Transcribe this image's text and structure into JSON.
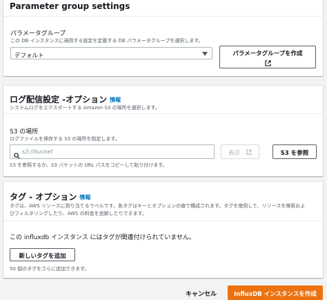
{
  "parameter_group": {
    "title": "Parameter group settings",
    "label": "パラメータグループ",
    "description": "この DB インスタンスに適用する設定を定義する DB パラメータグループを選択します。",
    "selected": "デフォルト",
    "create_button": "パラメータグループを作成"
  },
  "log_delivery": {
    "title": "ログ配信設定 -オプション",
    "info": "情報",
    "description": "システムログをエクスポートする Amazon S3 の場所を選択します。",
    "s3_label": "S3 の場所",
    "s3_description": "ログファイルを保存する S3 の場所を指定します。",
    "s3_placeholder": "s3://bucket",
    "view_button": "表示",
    "browse_button": "S3 を参照",
    "s3_hint": "S3 を参照するか、S3 バケットの URL パスをコピーして貼り付けます。"
  },
  "tags": {
    "title": "タグ - オプション",
    "info": "情報",
    "description_line1": "タグは、AWS リソースに割り当てるラベルです。各タグはキーとオプションの値で構成されます。タグを使用して、リソースを検索およ",
    "description_line2": "びフィルタリングしたり、AWS の料金を追跡したりできます。",
    "empty_text": "この influxdb インスタンス にはタグが関連付けられていません。",
    "add_button": "新しいタグを追加",
    "limit_text": "50 個のタグをさらに追加できます。"
  },
  "footer": {
    "cancel": "キャンセル",
    "create": "InfluxDB インスタンスを作成"
  },
  "colors": {
    "primary": "#ec7211",
    "link": "#0073bb"
  }
}
